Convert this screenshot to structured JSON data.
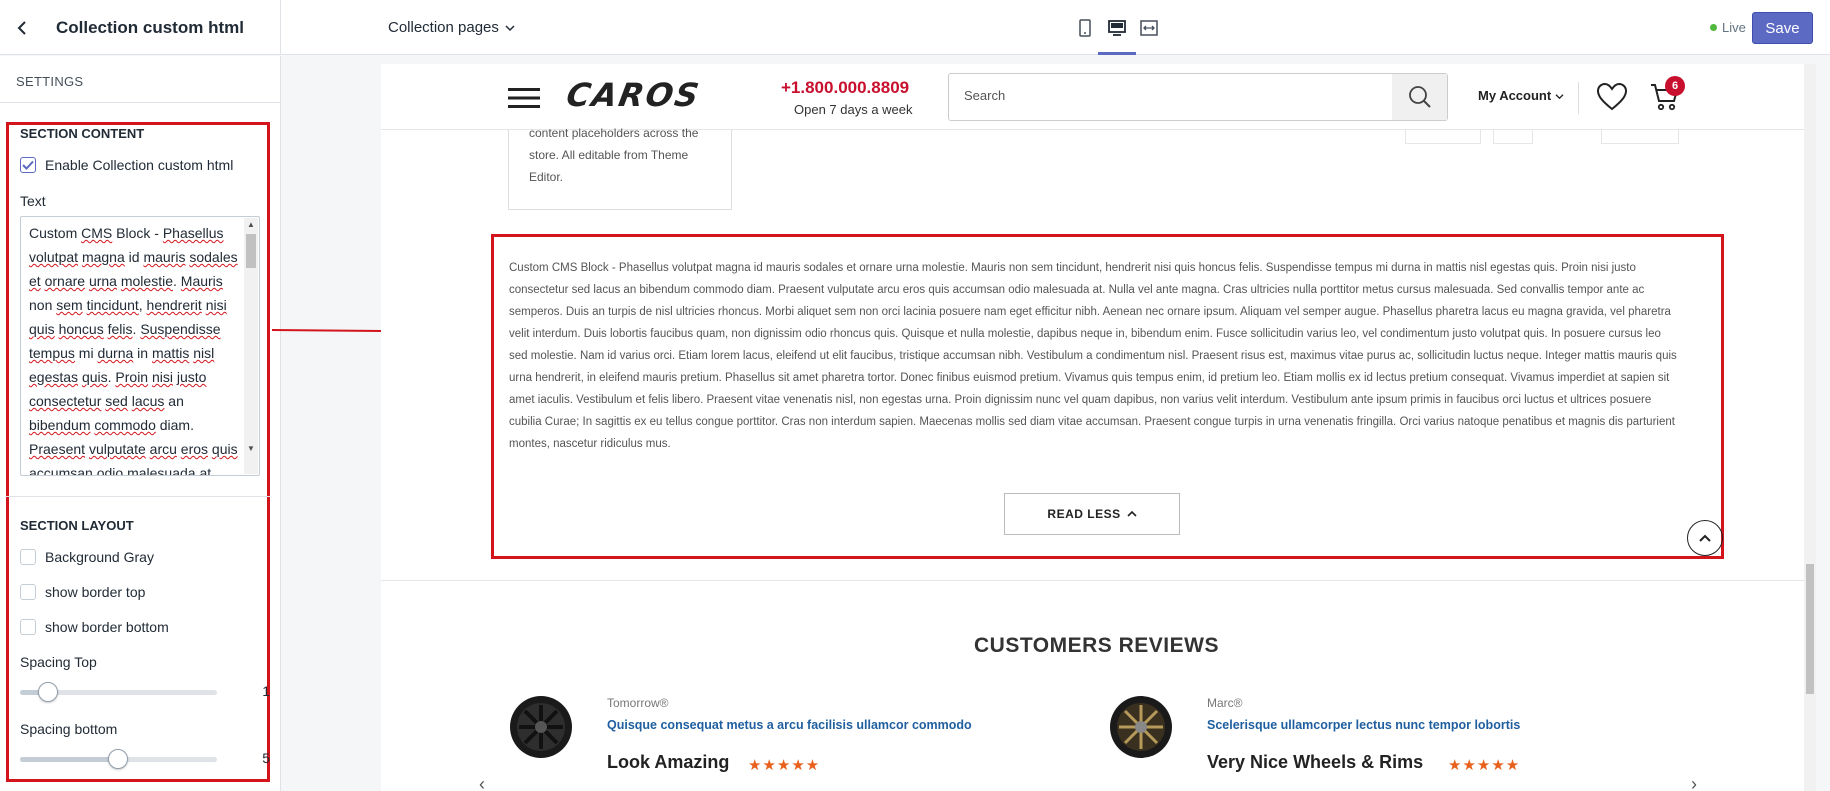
{
  "topbar": {
    "panel_title": "Collection custom html",
    "page_selector": "Collection pages",
    "status": "Live",
    "save_label": "Save"
  },
  "sidebar": {
    "settings_label": "SETTINGS",
    "section_content": {
      "heading": "SECTION CONTENT",
      "enable_label": "Enable Collection custom html",
      "enable_checked": true,
      "text_label": "Text"
    },
    "section_layout": {
      "heading": "SECTION LAYOUT",
      "background_gray": "Background Gray",
      "border_top": "show border top",
      "border_bottom": "show border bottom",
      "spacing_top_label": "Spacing Top",
      "spacing_top_value": "1",
      "spacing_bottom_label": "Spacing bottom",
      "spacing_bottom_value": "5"
    }
  },
  "site": {
    "logo": "CAROS",
    "phone": "+1.800.000.8809",
    "phone_sub": "Open 7 days a week",
    "search_placeholder": "Search",
    "account": "My Account",
    "cart_count": "6",
    "promo_text": "content placeholders across the store. All editable from Theme Editor.",
    "cms_text": "Custom CMS Block - Phasellus volutpat magna id mauris sodales et ornare urna molestie. Mauris non sem tincidunt, hendrerit nisi quis honcus felis. Suspendisse tempus mi durna in mattis nisl egestas quis. Proin nisi justo consectetur sed lacus an bibendum commodo diam. Praesent vulputate arcu eros quis accumsan odio malesuada at. Nulla vel ante magna. Cras ultricies nulla porttitor metus cursus malesuada. Sed convallis tempor ante ac semperos. Duis an turpis de nisl ultricies rhoncus. Morbi aliquet sem non orci lacinia posuere nam eget efficitur nibh. Aenean nec ornare ipsum. Aliquam vel semper augue. Phasellus pharetra lacus eu magna gravida, vel pharetra velit interdum. Duis lobortis faucibus quam, non dignissim odio rhoncus quis. Quisque et nulla molestie, dapibus neque in, bibendum enim. Fusce sollicitudin varius leo, vel condimentum justo volutpat quis. In posuere cursus leo sed molestie. Nam id varius orci. Etiam lorem lacus, eleifend ut elit faucibus, tristique accumsan nibh. Vestibulum a condimentum nisl. Praesent risus est, maximus vitae purus ac, sollicitudin luctus neque. Integer mattis mauris quis urna hendrerit, in eleifend mauris pretium. Phasellus sit amet pharetra tortor. Donec finibus euismod pretium. Vivamus quis tempus enim, id pretium leo. Etiam mollis ex id lectus pretium consequat. Vivamus imperdiet at sapien sit amet iaculis. Vestibulum et felis libero. Praesent vitae venenatis nisl, non egestas urna. Proin dignissim nunc vel quam dapibus, non varius velit interdum. Vestibulum ante ipsum primis in faucibus orci luctus et ultrices posuere cubilia Curae; In sagittis ex eu tellus congue porttitor. Cras non interdum sapien. Maecenas mollis sed diam vitae accumsan. Praesent congue turpis in urna venenatis fringilla. Orci varius natoque penatibus et magnis dis parturient montes, nascetur ridiculus mus.",
    "read_less": "READ LESS",
    "reviews_title": "CUSTOMERS REVIEWS",
    "reviews": [
      {
        "author": "Tomorrow®",
        "link": "Quisque consequat metus a arcu facilisis ullamcor commodo",
        "title": "Look Amazing",
        "stars": "★★★★★"
      },
      {
        "author": "Marc®",
        "link": "Scelerisque ullamcorper lectus nunc tempor lobortis",
        "title": "Very Nice Wheels & Rims",
        "stars": "★★★★★"
      }
    ]
  },
  "colors": {
    "accent": "#5c6ac4",
    "highlight": "#d4141c",
    "brand_red": "#c8102e",
    "star": "#e8601c"
  }
}
